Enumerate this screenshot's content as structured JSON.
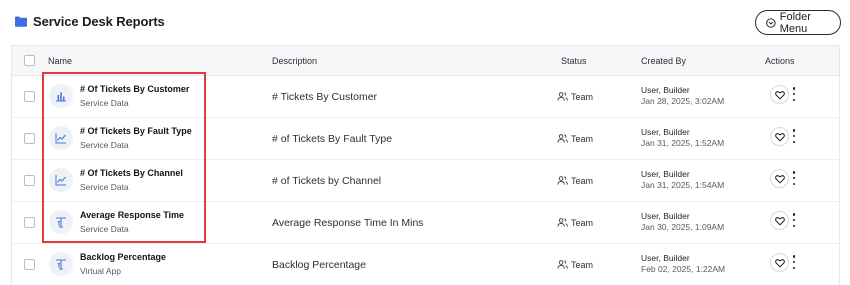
{
  "header": {
    "title": "Service Desk Reports",
    "folder_icon": "folder-icon",
    "folder_menu_label": "Folder Menu",
    "accent_color": "#3d6fe0"
  },
  "table": {
    "columns": {
      "name": "Name",
      "description": "Description",
      "status": "Status",
      "created_by": "Created By",
      "actions": "Actions"
    },
    "rows": [
      {
        "name": "# Of Tickets By Customer",
        "source": "Service Data",
        "icon": "bar-chart-icon",
        "description": "# Tickets By Customer",
        "status": "Team",
        "creator": "User, Builder",
        "created": "Jan 28, 2025, 3:02AM"
      },
      {
        "name": "# Of Tickets By Fault Type",
        "source": "Service Data",
        "icon": "line-chart-icon",
        "description": "# of Tickets By Fault Type",
        "status": "Team",
        "creator": "User, Builder",
        "created": "Jan 31, 2025, 1:52AM"
      },
      {
        "name": "# Of Tickets By Channel",
        "source": "Service Data",
        "icon": "line-chart-icon",
        "description": "# of Tickets by Channel",
        "status": "Team",
        "creator": "User, Builder",
        "created": "Jan 31, 2025, 1:54AM"
      },
      {
        "name": "Average Response Time",
        "source": "Service Data",
        "icon": "text-format-icon",
        "description": "Average Response Time In Mins",
        "status": "Team",
        "creator": "User, Builder",
        "created": "Jan 30, 2025, 1:09AM"
      },
      {
        "name": "Backlog Percentage",
        "source": "Virtual App",
        "icon": "text-format-icon",
        "description": "Backlog Percentage",
        "status": "Team",
        "creator": "User, Builder",
        "created": "Feb 02, 2025, 1:22AM"
      }
    ]
  },
  "highlight_color": "#e23b3b"
}
